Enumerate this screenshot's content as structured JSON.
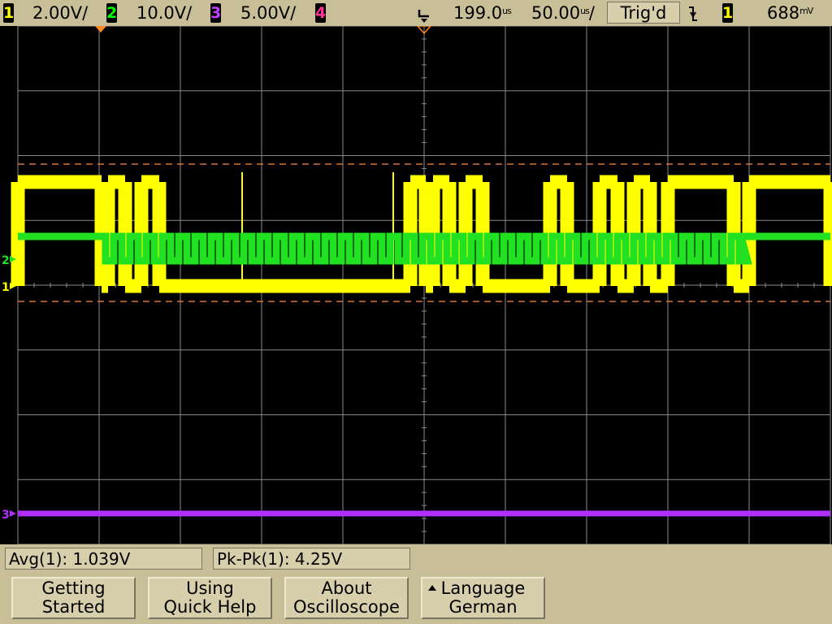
{
  "status_bar": {
    "ch1": {
      "num": "1",
      "scale": "2.00V/",
      "color": "#ffff00"
    },
    "ch2": {
      "num": "2",
      "scale": "10.0V/",
      "color": "#00ff00"
    },
    "ch3": {
      "num": "3",
      "scale": "5.00V/",
      "color": "#c040ff"
    },
    "ch4": {
      "num": "4",
      "scale": "",
      "color": "#ff3399"
    },
    "time_delay": {
      "value": "199.0",
      "unit": "us"
    },
    "time_scale": {
      "value": "50.00",
      "unit": "us",
      "suffix": "/"
    },
    "trigger_status": "Trig'd",
    "trigger_edge_icon": "falling-edge-icon",
    "trigger_source": "1",
    "trigger_level": {
      "value": "688",
      "unit": "mV"
    }
  },
  "screen": {
    "channel_markers": {
      "ch1": "1",
      "ch2": "2",
      "ch3": "3"
    },
    "colors": {
      "ch1": "#ffff00",
      "ch2": "#22e022",
      "ch3": "#b030ff",
      "grid": "#8a8a8a",
      "cursor": "#ff8844"
    }
  },
  "measurements": {
    "avg": "Avg(1): 1.039V",
    "pkpk": "Pk-Pk(1): 4.25V"
  },
  "softkeys": [
    {
      "line1": "Getting",
      "line2": "Started"
    },
    {
      "line1": "Using",
      "line2": "Quick Help"
    },
    {
      "line1": "About",
      "line2": "Oscilloscope"
    },
    {
      "line1": "Language",
      "line2": "German"
    }
  ]
}
